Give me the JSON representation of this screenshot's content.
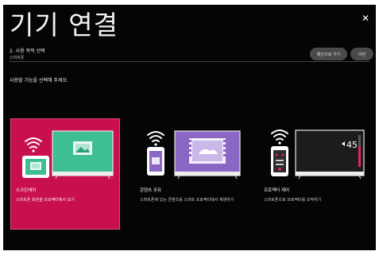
{
  "header": {
    "title": "기기 연결",
    "step": "2. 사용 목적 선택",
    "substep": "스마트폰",
    "close_icon": "close-icon"
  },
  "buttons": {
    "home": "메인으로 가기",
    "prev": "이전"
  },
  "instruction": "사용할 기능을 선택해 주세요.",
  "cards": [
    {
      "name": "스크린셰어",
      "desc": "스마트폰 화면을 프로젝터에서 보기",
      "icon": "screen-share-icon",
      "selected": true
    },
    {
      "name": "콘텐츠 공유",
      "desc": "스마트폰에 있는 콘텐츠를 스마트 프로젝터에서 재생하기",
      "icon": "content-share-icon",
      "selected": false
    },
    {
      "name": "프로젝터 제어",
      "desc": "스마트폰으로 프로젝터를 조작하기",
      "icon": "projector-control-icon",
      "selected": false
    }
  ],
  "remote_volume": "45",
  "colors": {
    "background": "#050505",
    "accent": "#c8104f",
    "tv_green": "#3dbf92",
    "tv_purple": "#8a67c4"
  }
}
